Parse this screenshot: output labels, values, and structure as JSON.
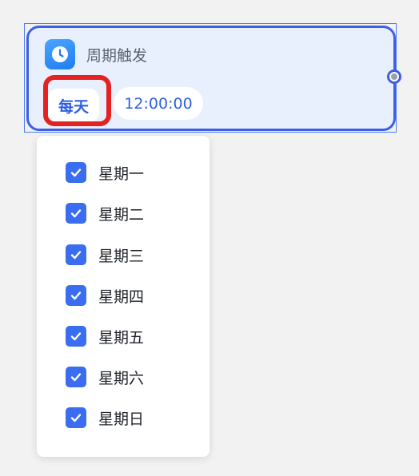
{
  "node": {
    "title": "周期触发",
    "icon": "clock-icon",
    "frequency": "每天",
    "time": "12:00:00"
  },
  "dropdown": {
    "options": [
      {
        "label": "星期一",
        "checked": true
      },
      {
        "label": "星期二",
        "checked": true
      },
      {
        "label": "星期三",
        "checked": true
      },
      {
        "label": "星期四",
        "checked": true
      },
      {
        "label": "星期五",
        "checked": true
      },
      {
        "label": "星期六",
        "checked": true
      },
      {
        "label": "星期日",
        "checked": true
      }
    ]
  },
  "colors": {
    "accent": "#3a6df0",
    "node_border": "#3f5ee6",
    "node_bg": "#e9f0fd",
    "highlight": "#e52222"
  }
}
